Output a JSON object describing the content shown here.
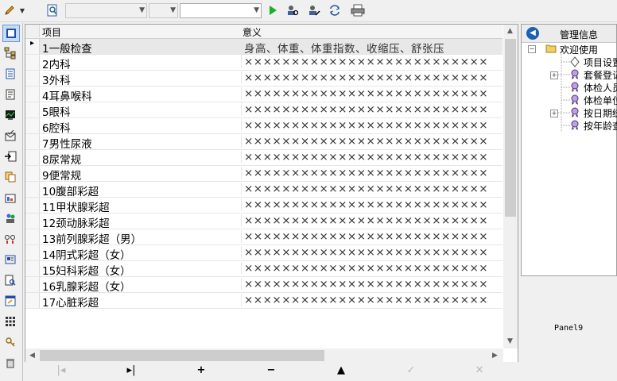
{
  "toolbar": {
    "icons": [
      "pencil-icon",
      "dropdown-arrow-icon",
      "magnifier-doc-icon",
      "play-icon",
      "person-search-icon",
      "person-edit-icon",
      "refresh-icon",
      "printer-icon"
    ],
    "combo1": "",
    "combo2": "",
    "combo3": ""
  },
  "grid": {
    "col_item": "项目",
    "col_meaning": "意义",
    "rows": [
      {
        "item": "1一般检查",
        "meaning": "身高、体重、体重指数、收缩压、舒张压"
      },
      {
        "item": "2内科",
        "meaning": "××××××××××××××××××××××××××"
      },
      {
        "item": "3外科",
        "meaning": "××××××××××××××××××××××××××"
      },
      {
        "item": "4耳鼻喉科",
        "meaning": "××××××××××××××××××××××××××"
      },
      {
        "item": "5眼科",
        "meaning": "××××××××××××××××××××××××××"
      },
      {
        "item": "6腔科",
        "meaning": "××××××××××××××××××××××××××"
      },
      {
        "item": "7男性尿液",
        "meaning": "××××××××××××××××××××××××××"
      },
      {
        "item": "8尿常规",
        "meaning": "××××××××××××××××××××××××××"
      },
      {
        "item": "9便常规",
        "meaning": "××××××××××××××××××××××××××"
      },
      {
        "item": "10腹部彩超",
        "meaning": "××××××××××××××××××××××××××"
      },
      {
        "item": "11甲状腺彩超",
        "meaning": "××××××××××××××××××××××××××"
      },
      {
        "item": "12颈动脉彩超",
        "meaning": "××××××××××××××××××××××××××"
      },
      {
        "item": "13前列腺彩超（男）",
        "meaning": "××××××××××××××××××××××××××"
      },
      {
        "item": "14阴式彩超（女）",
        "meaning": "××××××××××××××××××××××××××"
      },
      {
        "item": "15妇科彩超（女）",
        "meaning": "××××××××××××××××××××××××××"
      },
      {
        "item": "16乳腺彩超（女）",
        "meaning": "××××××××××××××××××××××××××"
      },
      {
        "item": "17心脏彩超",
        "meaning": "××××××××××××××××××××××××××"
      }
    ]
  },
  "navigator": {
    "first": "|◂",
    "last": "▸|",
    "insert": "+",
    "delete": "−",
    "edit": "▲",
    "post": "✓",
    "cancel": "✕"
  },
  "right_panel": {
    "title": "管理信息",
    "tree": {
      "root": "欢迎使用",
      "items": [
        "项目设置",
        "套餐登记",
        "体检人员",
        "体检单位",
        "按日期统",
        "按年龄查"
      ]
    }
  },
  "panel9": "Panel9"
}
